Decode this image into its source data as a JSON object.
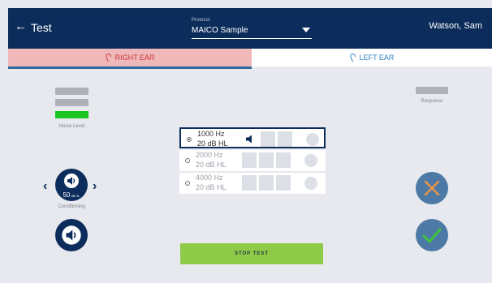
{
  "header": {
    "title": "Test",
    "protocol_label": "Protocol",
    "protocol_value": "MAICO Sample",
    "user": "Watson, Sam"
  },
  "tabs": [
    {
      "label": "RIGHT EAR",
      "active": true
    },
    {
      "label": "LEFT EAR",
      "active": false
    }
  ],
  "left_panel": {
    "noise_label": "Noise Level",
    "conditioning_value": "50",
    "conditioning_unit": "dB HL",
    "conditioning_label": "Conditioning"
  },
  "response_label": "Response",
  "frequencies": [
    {
      "hz": "1000 Hz",
      "level": "20 dB HL",
      "selected": true
    },
    {
      "hz": "2000 Hz",
      "level": "20 dB HL",
      "selected": false
    },
    {
      "hz": "4000 Hz",
      "level": "20 dB HL",
      "selected": false
    }
  ],
  "stop_button": "STOP TEST",
  "icons": {
    "back": "back-arrow-icon",
    "dropdown": "chevron-down-icon",
    "ear_right": "ear-icon",
    "ear_left": "ear-icon",
    "speaker": "speaker-icon",
    "prev": "chevron-left-icon",
    "next": "chevron-right-icon",
    "cancel": "close-icon",
    "confirm": "checkmark-icon"
  },
  "colors": {
    "header": "#0c2d5b",
    "right_ear_tab": "#efb8b9",
    "right_ear_text": "#d0353c",
    "left_ear_text": "#2d84c2",
    "noise_ok": "#19c521",
    "stop_button": "#8fcb48",
    "action_circle": "#4c79a5"
  }
}
